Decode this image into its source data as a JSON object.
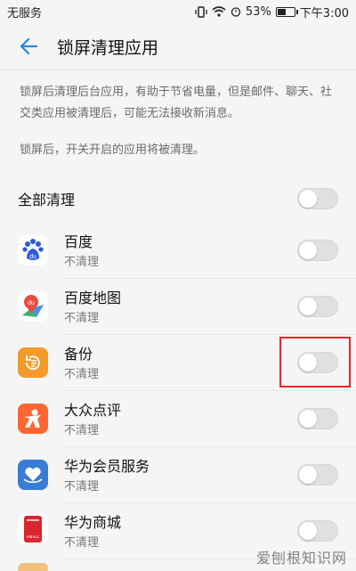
{
  "statusbar": {
    "carrier": "无服务",
    "battery": "53%",
    "battery_level": 0.53,
    "time": "下午3:00"
  },
  "header": {
    "title": "锁屏清理应用"
  },
  "description": {
    "line1": "锁屏后清理后台应用，有助于节省电量，但是邮件、聊天、社交类应用被清理后，可能无法接收新消息。",
    "line2": "锁屏后，开关开启的应用将被清理。"
  },
  "all_clean": {
    "label": "全部清理",
    "enabled": false
  },
  "apps": [
    {
      "name": "百度",
      "status": "不清理",
      "icon": "baidu-paw-icon",
      "enabled": false
    },
    {
      "name": "百度地图",
      "status": "不清理",
      "icon": "baidu-map-icon",
      "enabled": false
    },
    {
      "name": "备份",
      "status": "不清理",
      "icon": "backup-icon",
      "enabled": false
    },
    {
      "name": "大众点评",
      "status": "不清理",
      "icon": "dianping-icon",
      "enabled": false
    },
    {
      "name": "华为会员服务",
      "status": "不清理",
      "icon": "huawei-member-icon",
      "enabled": false
    },
    {
      "name": "华为商城",
      "status": "不清理",
      "icon": "vmall-icon",
      "enabled": false
    }
  ],
  "watermark": "爱刨根知识网",
  "colors": {
    "highlight": "#e02a2a",
    "backup_orange": "#f39a2b",
    "dianping_orange": "#ff6633",
    "huawei_member_blue": "#3a7bd5",
    "vmall_red": "#d9262c",
    "back_arrow": "#1e88e5"
  }
}
